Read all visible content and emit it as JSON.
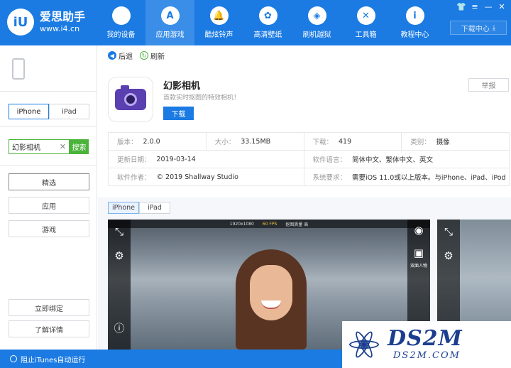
{
  "header": {
    "logo_badge": "iU",
    "logo_name": "爱思助手",
    "logo_url": "www.i4.cn",
    "nav": [
      {
        "label": "我的设备",
        "icon": "apple-icon",
        "glyph": ""
      },
      {
        "label": "应用游戏",
        "icon": "app-store-icon",
        "glyph": "A"
      },
      {
        "label": "酷炫铃声",
        "icon": "bell-icon",
        "glyph": "🔔"
      },
      {
        "label": "高清壁纸",
        "icon": "flower-icon",
        "glyph": "✿"
      },
      {
        "label": "刷机越狱",
        "icon": "box-icon",
        "glyph": "◈"
      },
      {
        "label": "工具箱",
        "icon": "tools-icon",
        "glyph": "✕"
      },
      {
        "label": "教程中心",
        "icon": "info-icon",
        "glyph": "i"
      }
    ],
    "active_nav_index": 1,
    "window_controls": [
      "👕",
      "≡",
      "—",
      "✕"
    ],
    "download_center": "下载中心",
    "download_glyph": "⤓"
  },
  "sidebar": {
    "device_tabs": [
      "iPhone",
      "iPad"
    ],
    "search_value": "幻影相机",
    "search_clear": "✕",
    "search_button": "搜索",
    "categories": [
      "精选",
      "应用",
      "游戏"
    ],
    "selected_category": "精选",
    "bind_now": "立即绑定",
    "learn_more": "了解详情"
  },
  "toolbar": {
    "back": "后退",
    "back_glyph": "◀",
    "refresh": "刷新",
    "refresh_glyph": "↻"
  },
  "app": {
    "name": "幻影相机",
    "description": "首款实时抠图的特效相机！",
    "download": "下载",
    "report": "举报",
    "info": {
      "version_key": "版本：",
      "version": "2.0.0",
      "size_key": "大小：",
      "size": "33.15MB",
      "downloads_key": "下载：",
      "downloads": "419",
      "category_key": "类别：",
      "category": "摄像",
      "updated_key": "更新日期：",
      "updated": "2019-03-14",
      "language_key": "软件语言：",
      "language": "简体中文、繁体中文、英文",
      "author_key": "软件作者：",
      "author": "© 2019 Shallway Studio",
      "requirements_key": "系统要求：",
      "requirements": "需要iOS 11.0或以上版本。与iPhone、iPad、iPod"
    }
  },
  "screenshots": {
    "tabs": [
      "iPhone",
      "iPad"
    ],
    "active_tab": "iPhone",
    "overlay_res": "1920x1080",
    "overlay_fps": "60 FPS",
    "overlay_right": "抠图质量 高",
    "side_label": "双面人物"
  },
  "footer": {
    "itunes_block": "阻止iTunes自动运行"
  },
  "watermark": {
    "big": "DS2M",
    "small": "DS2M.COM"
  }
}
